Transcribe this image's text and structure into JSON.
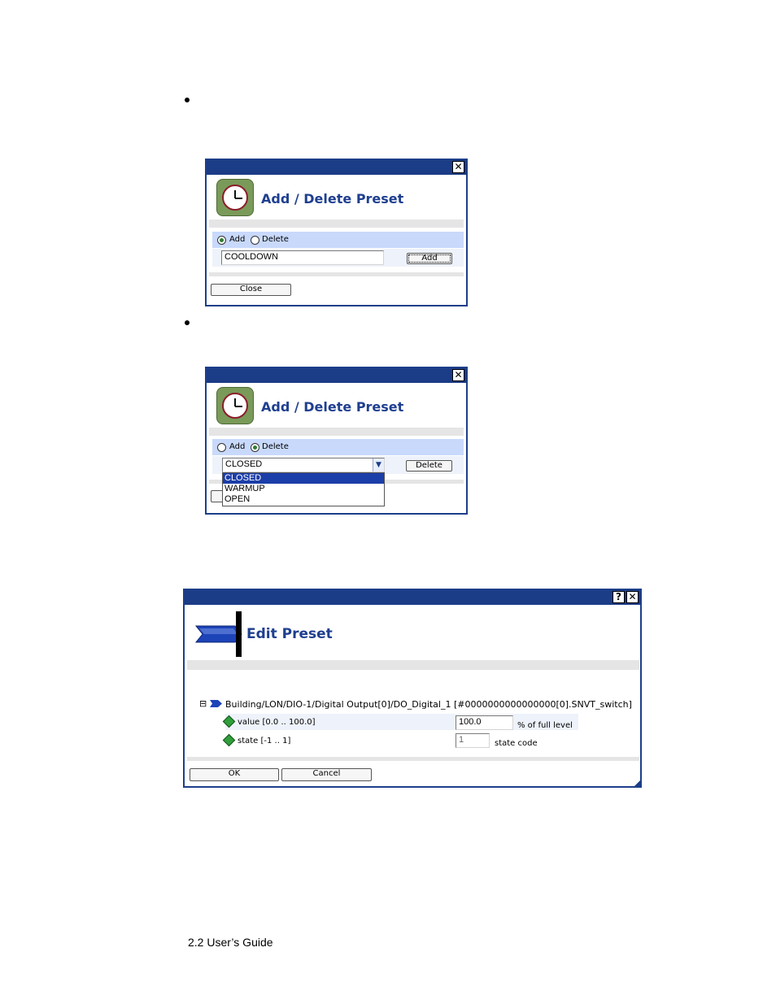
{
  "dialog1": {
    "close_glyph": "✕",
    "title": "Add / Delete Preset",
    "icon": "clock-icon",
    "radio_add": "Add",
    "radio_delete": "Delete",
    "selected_mode": "Add",
    "preset_name_value": "COOLDOWN",
    "add_button": "Add",
    "close_button": "Close"
  },
  "dialog2": {
    "close_glyph": "✕",
    "title": "Add / Delete Preset",
    "icon": "clock-icon",
    "radio_add": "Add",
    "radio_delete": "Delete",
    "selected_mode": "Delete",
    "select_value": "CLOSED",
    "options": [
      "CLOSED",
      "WARMUP",
      "OPEN"
    ],
    "delete_button": "Delete"
  },
  "dialog3": {
    "help_glyph": "?",
    "close_glyph": "✕",
    "title": "Edit Preset",
    "icon": "arrow-icon",
    "collapse_glyph": "⊟",
    "tree_path": "Building/LON/DIO-1/Digital Output[0]/DO_Digital_1 [#0000000000000000[0].SNVT_switch]",
    "fields": [
      {
        "label": "value [0.0 .. 100.0]",
        "value": "100.0",
        "unit": "% of full level"
      },
      {
        "label": "state [-1 .. 1]",
        "value": "1",
        "unit": "state code"
      }
    ],
    "ok_button": "OK",
    "cancel_button": "Cancel"
  },
  "footer": {
    "text": "2.2 User’s Guide"
  },
  "colors": {
    "titlebar": "#1b3c86",
    "title_text": "#1f3f8f",
    "band_blue": "#c8d9fb",
    "band_gray": "#e5e5e5"
  }
}
